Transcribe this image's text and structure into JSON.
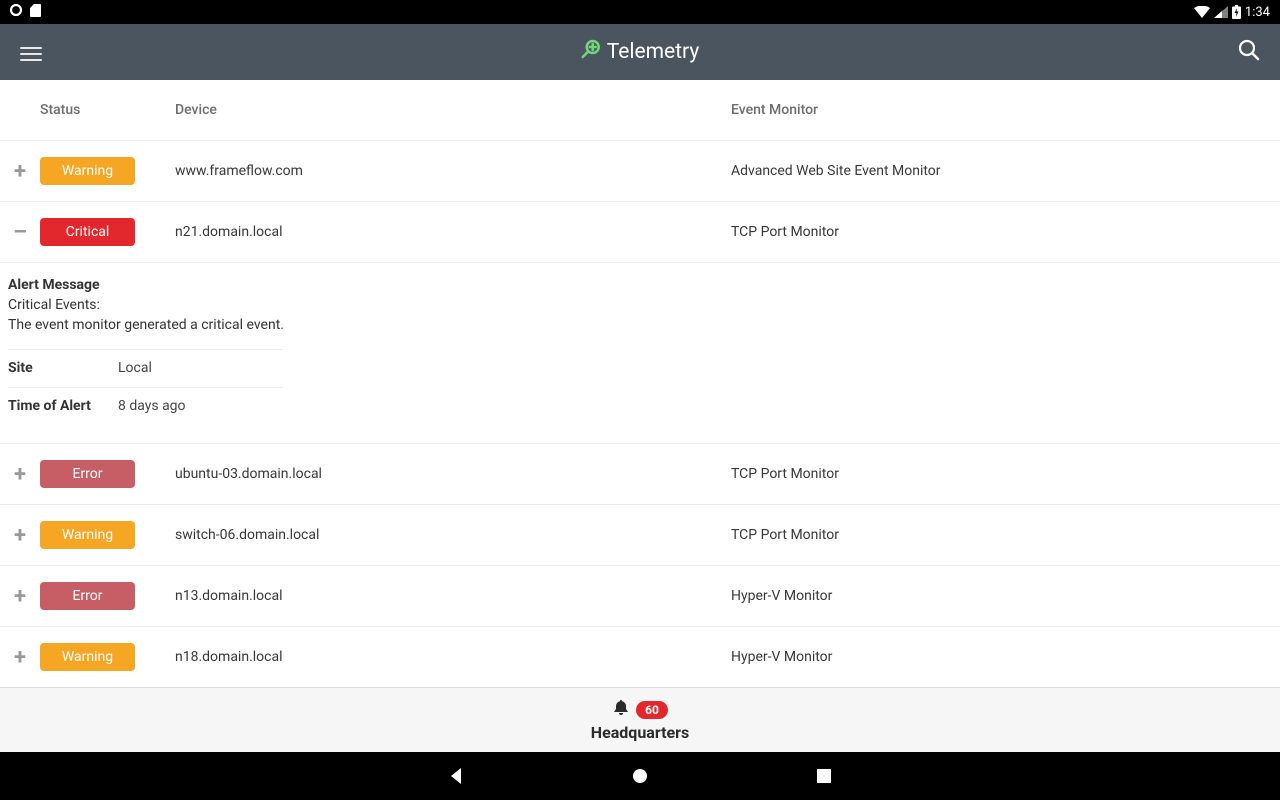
{
  "statusbar": {
    "time": "1:34"
  },
  "header": {
    "title": "Telemetry"
  },
  "columns": {
    "status": "Status",
    "device": "Device",
    "monitor": "Event Monitor"
  },
  "rows": [
    {
      "status": "Warning",
      "badge": "warning",
      "device": "www.frameflow.com",
      "monitor": "Advanced Web Site Event Monitor",
      "expanded": false
    },
    {
      "status": "Critical",
      "badge": "critical",
      "device": "n21.domain.local",
      "monitor": "TCP Port Monitor",
      "expanded": true
    },
    {
      "status": "Error",
      "badge": "error",
      "device": "ubuntu-03.domain.local",
      "monitor": "TCP Port Monitor",
      "expanded": false
    },
    {
      "status": "Warning",
      "badge": "warning",
      "device": "switch-06.domain.local",
      "monitor": "TCP Port Monitor",
      "expanded": false
    },
    {
      "status": "Error",
      "badge": "error",
      "device": "n13.domain.local",
      "monitor": "Hyper-V Monitor",
      "expanded": false
    },
    {
      "status": "Warning",
      "badge": "warning",
      "device": "n18.domain.local",
      "monitor": "Hyper-V Monitor",
      "expanded": false
    }
  ],
  "detail": {
    "heading": "Alert Message",
    "line1": "Critical Events:",
    "line2": "The event monitor generated a critical event.",
    "site_k": "Site",
    "site_v": "Local",
    "time_k": "Time of Alert",
    "time_v": "8 days ago"
  },
  "bottom": {
    "count": "60",
    "label": "Headquarters"
  }
}
